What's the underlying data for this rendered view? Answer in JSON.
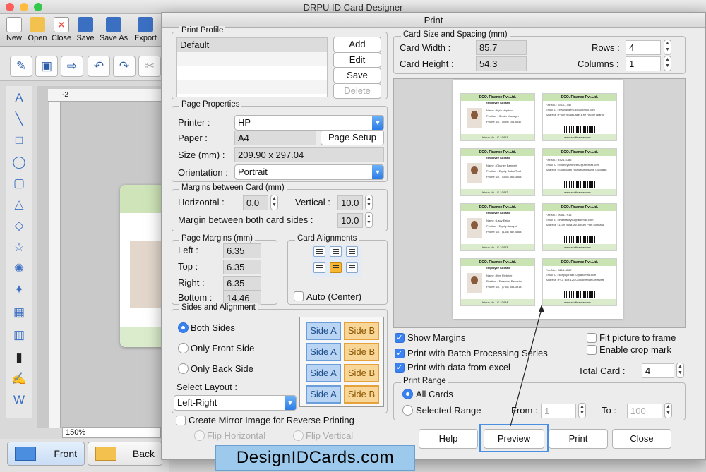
{
  "app": {
    "title": "DRPU ID Card Designer",
    "toolbar": [
      {
        "label": "New",
        "color": "#ffffff"
      },
      {
        "label": "Open",
        "color": "#f2c14e"
      },
      {
        "label": "Close",
        "color": "#e84a3c"
      },
      {
        "label": "Save",
        "color": "#3b6fc2"
      },
      {
        "label": "Save As",
        "color": "#3b6fc2"
      },
      {
        "label": "Export",
        "color": "#3b6fc2"
      }
    ],
    "ruler_tick": "-2",
    "zoom": "150%",
    "bottom_tabs": {
      "front": "Front",
      "back": "Back"
    }
  },
  "dialog": {
    "title": "Print",
    "print_profile": {
      "label": "Print Profile",
      "items": [
        "Default"
      ],
      "add": "Add",
      "edit": "Edit",
      "save": "Save",
      "delete": "Delete"
    },
    "page_properties": {
      "label": "Page Properties",
      "printer_label": "Printer :",
      "printer": "HP",
      "paper_label": "Paper :",
      "paper": "A4",
      "page_setup": "Page Setup",
      "size_label": "Size (mm) :",
      "size": "209.90 x 297.04",
      "orientation_label": "Orientation :",
      "orientation": "Portrait"
    },
    "margins_between": {
      "label": "Margins between Card (mm)",
      "horizontal_label": "Horizontal :",
      "horizontal": "0.0",
      "vertical_label": "Vertical :",
      "vertical": "10.0",
      "both_label": "Margin between both card sides :",
      "both": "10.0"
    },
    "page_margins": {
      "label": "Page Margins (mm)",
      "left_label": "Left :",
      "left": "6.35",
      "top_label": "Top :",
      "top": "6.35",
      "right_label": "Right :",
      "right": "6.35",
      "bottom_label": "Bottom :",
      "bottom": "14.46"
    },
    "card_alignments": {
      "label": "Card Alignments",
      "auto_center": "Auto (Center)"
    },
    "sides": {
      "label": "Sides and Alignment",
      "both_sides": "Both Sides",
      "only_front": "Only Front Side",
      "only_back": "Only Back Side",
      "select_layout_label": "Select Layout :",
      "layout": "Left-Right",
      "side_a": "Side A",
      "side_b": "Side B"
    },
    "mirror": {
      "label": "Create Mirror Image for Reverse Printing",
      "flip_h": "Flip Horizontal",
      "flip_v": "Flip Vertical"
    },
    "card_size": {
      "label": "Card Size and Spacing (mm)",
      "width_label": "Card Width :",
      "width": "85.7",
      "height_label": "Card Height :",
      "height": "54.3",
      "rows_label": "Rows :",
      "rows": "4",
      "columns_label": "Columns :",
      "columns": "1"
    },
    "cards": [
      {
        "company": "ECO. Finance Pvt.Ltd.",
        "title": "Employee ID card",
        "name": "Kyla Hayden",
        "position": "Senior Manager",
        "phone": "(559) 104-5647",
        "unique": "E-10461",
        "back_fax": "5410-1457",
        "back_email": "xylahayden18@abcmail.com",
        "back_addr": "Prion Road Lake ,Erie Rhode Island",
        "site": "www.ecofinance.com"
      },
      {
        "company": "ECO. Finance Pvt.Ltd.",
        "title": "Employee ID card",
        "name": "Chaney Bennett",
        "position": "Equity Sales Trad",
        "phone": "(360) 669-3864",
        "unique": "E-10462",
        "back_fax": "4921-6785",
        "back_email": "bhaneybennett22@abcmail.com",
        "back_addr": "Sollicitudin Road,Burlingame Colorado",
        "site": "www.ecofinance.com"
      },
      {
        "company": "ECO. Finance Pvt.Ltd.",
        "title": "Employee ID card",
        "name": "Lacy Eaton",
        "position": "Equity Analyst",
        "phone": "(145) 987-4564",
        "unique": "E-10463",
        "back_fax": "9054-7915",
        "back_email": "imeritalley63@abcmail.com",
        "back_addr": "1379 Nulla. Av.Asbury Park Montana",
        "site": "www.ecofinance.com"
      },
      {
        "company": "ECO. Finance Pvt.Ltd.",
        "title": "Employee ID card",
        "name": "Kim Fletcher",
        "position": "Financial Reportin",
        "phone": "(750) 558-3914",
        "unique": "E-10464",
        "back_fax": "8216-4567",
        "back_email": "sonyajordan10@abcmail.com",
        "back_addr": "P.O. Box 120 Odio Avenue Delaware",
        "site": "www.ecofinance.com"
      }
    ],
    "card_field_labels": {
      "name": "Name",
      "position": "Position",
      "phone": "Phone No.",
      "unique": "Unique No.",
      "fax": "Fax No.",
      "email": "Email ID",
      "address": "Address"
    },
    "options": {
      "show_margins": "Show Margins",
      "batch": "Print with Batch Processing Series",
      "excel": "Print with data from excel",
      "fit_picture": "Fit picture to frame",
      "crop_mark": "Enable crop mark",
      "total_card_label": "Total Card :",
      "total_card": "4"
    },
    "print_range": {
      "label": "Print Range",
      "all_cards": "All Cards",
      "selected_range": "Selected Range",
      "from_label": "From :",
      "from": "1",
      "to_label": "To :",
      "to": "100"
    },
    "buttons": {
      "help": "Help",
      "preview": "Preview",
      "print": "Print",
      "close": "Close"
    }
  },
  "watermark": "DesignIDCards.com"
}
